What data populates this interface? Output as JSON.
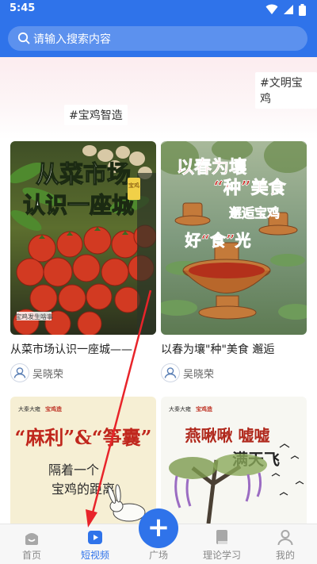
{
  "status": {
    "time": "5:45"
  },
  "search": {
    "placeholder": "请输入搜索内容"
  },
  "banner_tags": [
    "#文明宝鸡",
    "#宝鸡智造"
  ],
  "cards": [
    {
      "title": "从菜市场认识一座城——",
      "author": "吴晓荣",
      "poster_title": "从菜市场认识一座城",
      "poster_badge": "宝鸡",
      "poster_footer": "宝鸡发生啥事"
    },
    {
      "title": "以春为壤\"种\"美食 邂逅",
      "author": "吴晓荣",
      "poster_title_line1": "以春为壤",
      "poster_title_line2": "“种”美食",
      "poster_title_line3": "邂逅宝鸡",
      "poster_title_line4": "好“食”光"
    },
    {
      "poster_brand": "大秦大雍",
      "poster_brand_seal": "宝鸡造",
      "poster_line1": "“麻利”&“筝囊”",
      "poster_line2": "隔着一个",
      "poster_line3": "宝鸡的距离"
    },
    {
      "poster_brand": "大秦大雍",
      "poster_brand_seal": "宝鸡造",
      "poster_line1": "燕啾啾 嘘嘘",
      "poster_line2": "满天飞"
    }
  ],
  "tabbar": {
    "home": "首页",
    "shortvideo": "短视频",
    "plaza": "广场",
    "study": "理论学习",
    "mine": "我的",
    "plus_symbol": "+"
  },
  "colors": {
    "accent": "#2f73ea",
    "header": "#2f73ea",
    "annotation_arrow": "#e8242a"
  },
  "icons": [
    "search-icon",
    "wifi-icon",
    "signal-icon",
    "battery-icon",
    "home-icon",
    "video-icon",
    "plus-icon",
    "book-icon",
    "user-icon"
  ]
}
